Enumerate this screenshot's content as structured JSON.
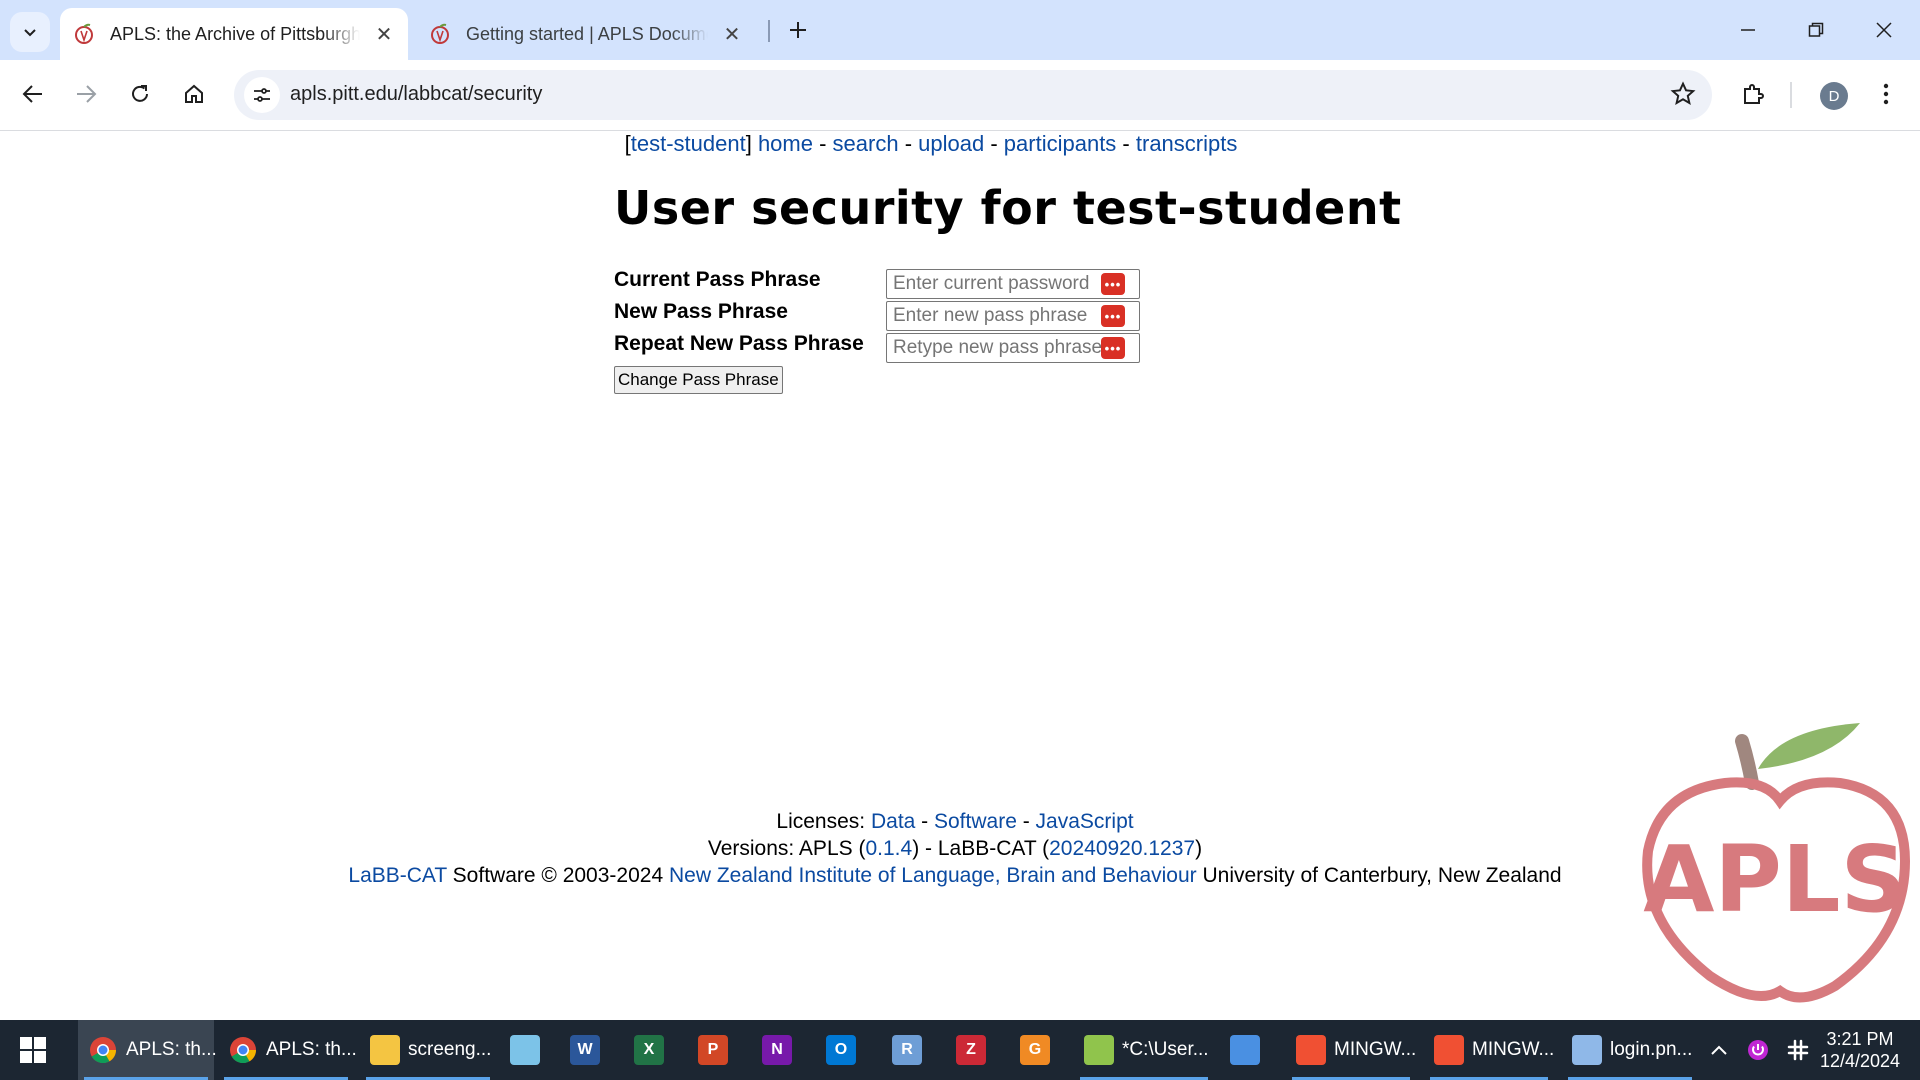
{
  "browser": {
    "tabs": [
      {
        "title": "APLS: the Archive of Pittsburgh",
        "active": true,
        "close": "✕"
      },
      {
        "title": "Getting started | APLS Documen",
        "active": false,
        "close": "✕"
      }
    ],
    "new_tab": "+",
    "url": "apls.pitt.edu/labbcat/security",
    "profile_initial": "D"
  },
  "nav": {
    "user": "test-student",
    "links": [
      "home",
      "search",
      "upload",
      "participants",
      "transcripts"
    ],
    "sep": " - "
  },
  "page": {
    "title": "User security for test-student",
    "fields": [
      {
        "label": "Current Pass Phrase",
        "placeholder": "Enter current password"
      },
      {
        "label": "New Pass Phrase",
        "placeholder": "Enter new pass phrase"
      },
      {
        "label": "Repeat New Pass Phrase",
        "placeholder": "Retype new pass phrase"
      }
    ],
    "submit_label": "Change Pass Phrase",
    "key_icon_text": "•••"
  },
  "footer": {
    "licenses_prefix": "Licenses: ",
    "licenses": [
      "Data",
      "Software",
      "JavaScript"
    ],
    "versions_prefix": "Versions: APLS (",
    "apls_version": "0.1.4",
    "versions_mid": ") - LaBB-CAT (",
    "labbcat_version": "20240920.1237",
    "versions_suffix": ")",
    "labbcat_link": "LaBB-CAT",
    "copyright": " Software © 2003-2024 ",
    "institute": "New Zealand Institute of Language, Brain and Behaviour",
    "university": " University of Canterbury, New Zealand"
  },
  "logo_text": "APLS",
  "taskbar": {
    "items": [
      {
        "label": "APLS: th...",
        "icon": "chrome-icon",
        "active": true
      },
      {
        "label": "APLS: th...",
        "icon": "chrome-icon",
        "active": false
      },
      {
        "label": "screeng...",
        "icon": "file-explorer-icon",
        "active": false
      },
      {
        "label": "",
        "icon": "notepad-icon",
        "active": false
      },
      {
        "label": "",
        "icon": "word-icon",
        "glyph": "W",
        "active": false
      },
      {
        "label": "",
        "icon": "excel-icon",
        "glyph": "X",
        "active": false
      },
      {
        "label": "",
        "icon": "powerpoint-icon",
        "glyph": "P",
        "active": false
      },
      {
        "label": "",
        "icon": "onenote-icon",
        "glyph": "N",
        "active": false
      },
      {
        "label": "",
        "icon": "outlook-icon",
        "glyph": "O",
        "active": false
      },
      {
        "label": "",
        "icon": "r-icon",
        "glyph": "R",
        "active": false
      },
      {
        "label": "",
        "icon": "zotero-icon",
        "glyph": "Z",
        "active": false
      },
      {
        "label": "",
        "icon": "pdf-icon",
        "glyph": "G",
        "active": false
      },
      {
        "label": "*C:\\User...",
        "icon": "notepadpp-icon",
        "active": false
      },
      {
        "label": "",
        "icon": "windows-media-icon",
        "active": false
      },
      {
        "label": "MINGW...",
        "icon": "git-icon",
        "active": false
      },
      {
        "label": "MINGW...",
        "icon": "git-icon",
        "active": false
      },
      {
        "label": "login.pn...",
        "icon": "paint-icon",
        "active": false
      }
    ],
    "time": "3:21 PM",
    "date": "12/4/2024"
  },
  "colors": {
    "link": "#0b4aa1",
    "tabbar": "#d3e3fd",
    "taskbar": "#1c2632",
    "logo_pink": "#d77a7e",
    "logo_leaf": "#8fb76a",
    "logo_stem": "#a0877f"
  }
}
